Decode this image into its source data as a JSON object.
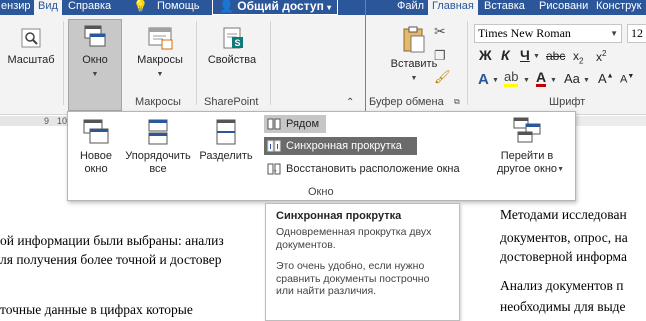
{
  "left_window": {
    "tabs": [
      "ензир",
      "Вид",
      "Справка",
      "Помощь",
      "Общий доступ"
    ],
    "ribbon": {
      "buttons": {
        "zoom": "Масштаб",
        "window": "Окно",
        "macros": "Макросы",
        "properties": "Свойства"
      },
      "groups": {
        "macros": "Макросы",
        "sharepoint": "SharePoint"
      },
      "ruler_numbers": [
        "9",
        "10"
      ]
    },
    "document_lines": [
      "ой информации были выбраны: анализ",
      "ля получения более точной и достовер",
      "точные данные в цифрах которые"
    ]
  },
  "right_window": {
    "tabs": [
      "Файл",
      "Главная",
      "Вставка",
      "Рисовани",
      "Конструк"
    ],
    "ribbon": {
      "paste": "Вставить",
      "clipboard_group": "Буфер обмена",
      "font_group": "Шрифт",
      "font_name": "Times New Roman",
      "font_size": "12"
    },
    "document_lines": [
      "Методами исследован",
      "документов, опрос, на",
      "достоверной информа",
      "Анализ документов п",
      "необходимы для выде"
    ]
  },
  "window_menu": {
    "new_window": "Новое окно",
    "arrange_all": "Упорядочить все",
    "split": "Разделить",
    "side_by_side": "Рядом",
    "sync_scroll": "Синхронная прокрутка",
    "reset_position": "Восстановить расположение окна",
    "switch_windows": "Перейти в другое окно",
    "group_label": "Окно"
  },
  "tooltip": {
    "title": "Синхронная прокрутка",
    "p1": "Одновременная прокрутка двух документов.",
    "p2": "Это очень удобно, если нужно сравнить документы построчно или найти различия."
  },
  "colors": {
    "word_blue": "#2b579a",
    "ribbon_bg": "#f3f3f3",
    "share_purple": "#7030a0",
    "highlight_yellow": "#ffff00",
    "font_red": "#c00000"
  }
}
